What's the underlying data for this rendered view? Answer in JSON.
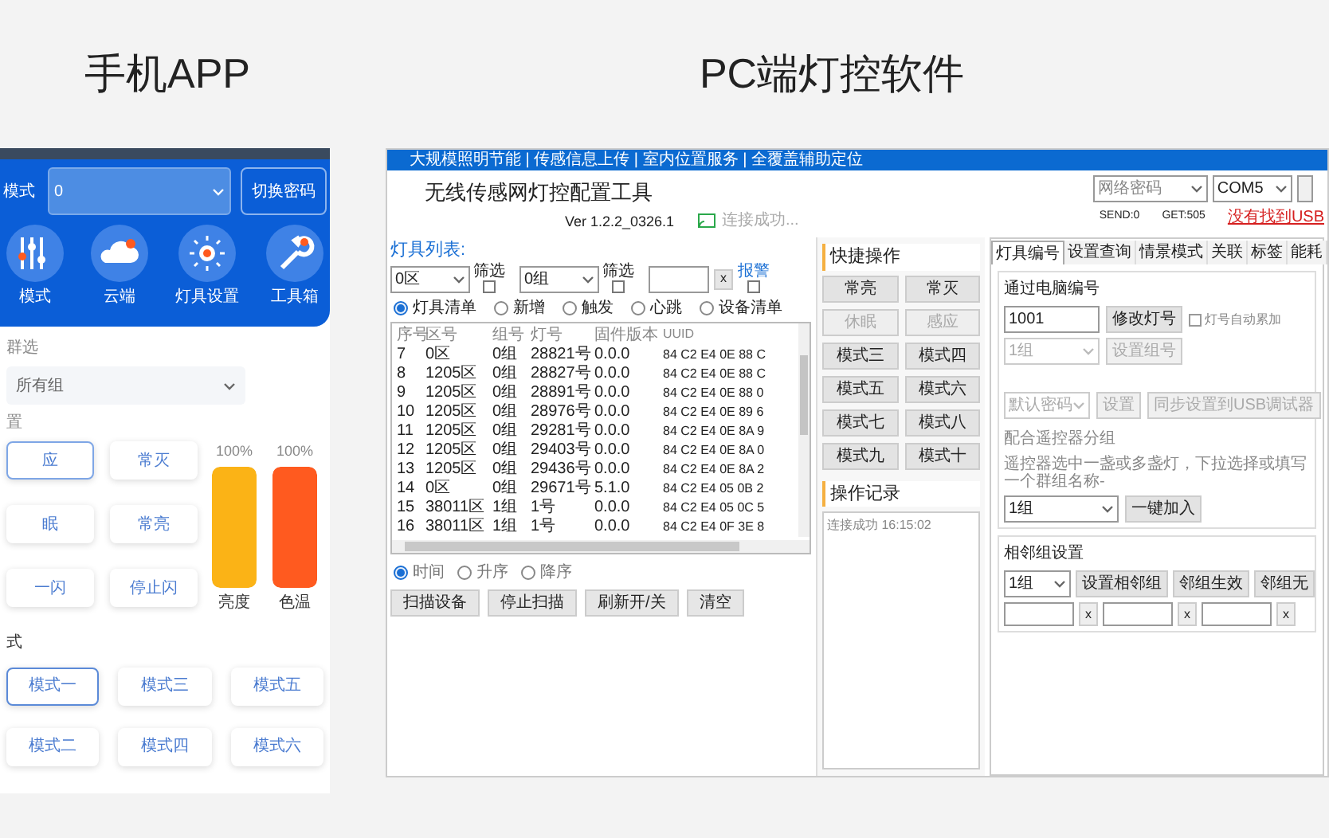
{
  "app_heading": "手机APP",
  "pc_heading": "PC端灯控软件",
  "phone": {
    "corner_label": "模式",
    "device_select": {
      "value": "0"
    },
    "switch_button": "切换密码",
    "nav": [
      {
        "label": "模式",
        "kind": "sliders"
      },
      {
        "label": "云端",
        "kind": "cloud"
      },
      {
        "label": "灯具设置",
        "kind": "sun"
      },
      {
        "label": "工具箱",
        "kind": "wrench"
      }
    ],
    "group_caption": "群选",
    "group_select": {
      "value": "所有组"
    },
    "control_caption": "置",
    "actions": [
      {
        "label": "应",
        "selected": true
      },
      {
        "label": "常灭",
        "selected": false
      },
      {
        "label": "眠",
        "selected": false
      },
      {
        "label": "常亮",
        "selected": false
      },
      {
        "label": "一闪",
        "selected": false
      },
      {
        "label": "停止闪",
        "selected": false
      }
    ],
    "sliders": [
      {
        "reading": "100%",
        "level": 1,
        "label": "亮度",
        "color": "#fbb316"
      },
      {
        "reading": "100%",
        "level": 1,
        "label": "色温",
        "color": "#ff5a1f"
      }
    ],
    "mode_caption": "式",
    "modes": [
      {
        "label": "模式一",
        "selected": true
      },
      {
        "label": "模式三",
        "selected": false
      },
      {
        "label": "模式五",
        "selected": false
      },
      {
        "label": "模式二",
        "selected": false
      },
      {
        "label": "模式四",
        "selected": false
      },
      {
        "label": "模式六",
        "selected": false
      }
    ]
  },
  "pc": {
    "title_bar": "大规模照明节能 | 传感信息上传 | 室内位置服务 | 全覆盖辅助定位",
    "app_title": "无线传感网灯控配置工具",
    "version": "Ver 1.2.2_0326.1",
    "connection_status": "连接成功...",
    "password_select": {
      "value": "网络密码"
    },
    "port_select": {
      "value": "COM5"
    },
    "send": "SEND:0",
    "get": "GET:505",
    "usb_warning": "没有找到USB",
    "list_title": "灯具列表:",
    "filters": [
      {
        "value": "0区",
        "checkbox": {
          "text": "筛选",
          "checked": false
        }
      },
      {
        "value": "0组",
        "checkbox": {
          "text": "筛选",
          "checked": false
        }
      }
    ],
    "clear_button": "x",
    "alarm": {
      "label": "报警",
      "checked": false
    },
    "list_modes": [
      {
        "label": "灯具清单",
        "selected": true
      },
      {
        "label": "新增",
        "selected": false
      },
      {
        "label": "触发",
        "selected": false
      },
      {
        "label": "心跳",
        "selected": false
      },
      {
        "label": "设备清单",
        "selected": false
      }
    ],
    "table": {
      "columns": [
        "序号",
        "区号",
        "组号",
        "灯号",
        "固件版本",
        "UUID"
      ],
      "rows": [
        [
          "7",
          "0区",
          "0组",
          "28821号",
          "0.0.0",
          "84 C2 E4 0E 88 C"
        ],
        [
          "8",
          "1205区",
          "0组",
          "28827号",
          "0.0.0",
          "84 C2 E4 0E 88 C"
        ],
        [
          "9",
          "1205区",
          "0组",
          "28891号",
          "0.0.0",
          "84 C2 E4 0E 88 0"
        ],
        [
          "10",
          "1205区",
          "0组",
          "28976号",
          "0.0.0",
          "84 C2 E4 0E 89 6"
        ],
        [
          "11",
          "1205区",
          "0组",
          "29281号",
          "0.0.0",
          "84 C2 E4 0E 8A 9"
        ],
        [
          "12",
          "1205区",
          "0组",
          "29403号",
          "0.0.0",
          "84 C2 E4 0E 8A 0"
        ],
        [
          "13",
          "1205区",
          "0组",
          "29436号",
          "0.0.0",
          "84 C2 E4 0E 8A 2"
        ],
        [
          "14",
          "0区",
          "0组",
          "29671号",
          "5.1.0",
          "84 C2 E4 05 0B 2"
        ],
        [
          "15",
          "38011区",
          "1组",
          "1号",
          "0.0.0",
          "84 C2 E4 05 0C 5"
        ],
        [
          "16",
          "38011区",
          "1组",
          "1号",
          "0.0.0",
          "84 C2 E4 0F 3E 8"
        ]
      ]
    },
    "sort_modes": [
      {
        "label": "时间",
        "selected": true
      },
      {
        "label": "升序",
        "selected": false
      },
      {
        "label": "降序",
        "selected": false
      }
    ],
    "bottom_buttons": [
      "扫描设备",
      "停止扫描",
      "刷新开/关",
      "清空"
    ],
    "quick_title": "快捷操作",
    "quick_buttons": [
      {
        "label": "常亮",
        "disabled": false
      },
      {
        "label": "常灭",
        "disabled": false
      },
      {
        "label": "休眠",
        "disabled": true
      },
      {
        "label": "感应",
        "disabled": true
      },
      {
        "label": "模式三",
        "disabled": false
      },
      {
        "label": "模式四",
        "disabled": false
      },
      {
        "label": "模式五",
        "disabled": false
      },
      {
        "label": "模式六",
        "disabled": false
      },
      {
        "label": "模式七",
        "disabled": false
      },
      {
        "label": "模式八",
        "disabled": false
      },
      {
        "label": "模式九",
        "disabled": false
      },
      {
        "label": "模式十",
        "disabled": false
      }
    ],
    "log_title": "操作记录",
    "log_lines": [
      "连接成功 16:15:02"
    ],
    "tabs": [
      {
        "label": "灯具编号",
        "selected": true
      },
      {
        "label": "设置查询",
        "selected": false
      },
      {
        "label": "情景模式",
        "selected": false
      },
      {
        "label": "关联",
        "selected": false
      },
      {
        "label": "标签",
        "selected": false
      },
      {
        "label": "能耗",
        "selected": false
      }
    ],
    "number_group": {
      "title": "通过电脑编号",
      "number_field": {
        "value": "1001"
      },
      "modify_button": "修改灯号",
      "auto_increment": {
        "label": "灯号自动累加",
        "checked": false
      },
      "group_select": {
        "value": "1组"
      },
      "group_button": "设置组号"
    },
    "password_group": {
      "password_select": {
        "value": "默认密码"
      },
      "set_button": "设置",
      "sync_button": "同步设置到USB调试器"
    },
    "remote_group": {
      "title": "配合遥控器分组",
      "hint": "遥控器选中一盏或多盏灯，下拉选择或填写一个群组名称-",
      "group_select": {
        "value": "1组"
      },
      "join_button": "一键加入"
    },
    "neighbor_group": {
      "title": "相邻组设置",
      "group_select": {
        "value": "1组"
      },
      "buttons": [
        "设置相邻组",
        "邻组生效",
        "邻组无"
      ],
      "fields": [
        {
          "clear": "x"
        },
        {
          "clear": "x"
        },
        {
          "clear": "x"
        }
      ]
    }
  }
}
